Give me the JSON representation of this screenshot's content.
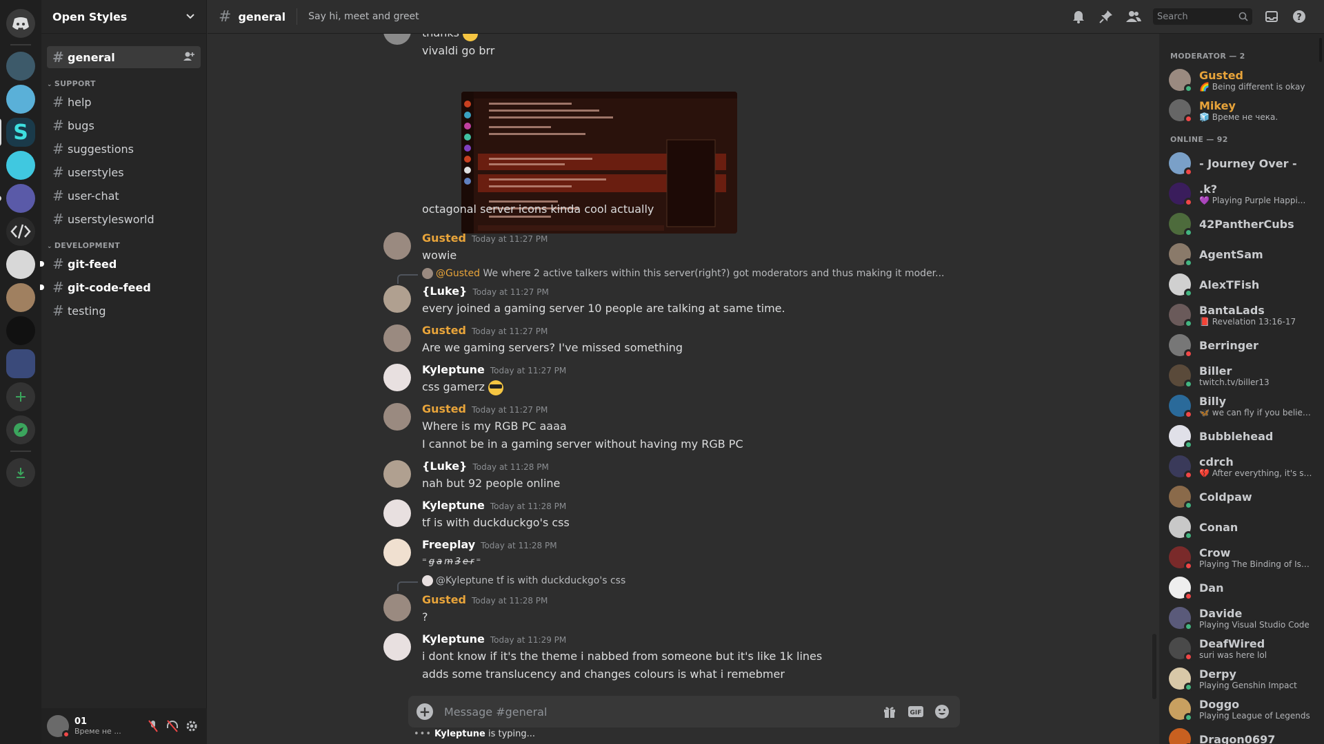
{
  "guild": {
    "name": "Open Styles"
  },
  "channel": {
    "name": "general",
    "topic": "Say hi, meet and greet"
  },
  "channels": {
    "top": [
      {
        "name": "general"
      }
    ],
    "categories": [
      {
        "label": "SUPPORT",
        "channels": [
          "help",
          "bugs",
          "suggestions",
          "userstyles",
          "user-chat",
          "userstylesworld"
        ]
      },
      {
        "label": "DEVELOPMENT",
        "channels": [
          "git-feed",
          "git-code-feed",
          "testing"
        ]
      }
    ]
  },
  "user_panel": {
    "name": "01",
    "status": "Време не ..."
  },
  "search": {
    "placeholder": "Search"
  },
  "messages": {
    "m0": {
      "partial_top": "thanks",
      "line2": "vivaldi go brr",
      "line3": "octagonal server icons kinda cool actually"
    },
    "m1": {
      "author": "Gusted",
      "ts": "Today at 11:27 PM",
      "lines": [
        "wowie"
      ]
    },
    "r1": {
      "mention": "@Gusted",
      "text": "We where 2 active talkers within this server(right?) got moderators and thus making it moder..."
    },
    "m2": {
      "author": "{Luke}",
      "ts": "Today at 11:27 PM",
      "lines": [
        "every joined a gaming server 10 people are talking at same time."
      ]
    },
    "m3": {
      "author": "Gusted",
      "ts": "Today at 11:27 PM",
      "lines": [
        "Are we gaming servers? I've missed something"
      ]
    },
    "m4": {
      "author": "Kyleptune",
      "ts": "Today at 11:27 PM",
      "lines": [
        "css gamerz"
      ]
    },
    "m5": {
      "author": "Gusted",
      "ts": "Today at 11:27 PM",
      "lines": [
        "Where is my RGB PC aaaa",
        "I cannot be in a gaming server without having my RGB PC"
      ]
    },
    "m6": {
      "author": "{Luke}",
      "ts": "Today at 11:28 PM",
      "lines": [
        "nah but 92 people online"
      ]
    },
    "m7": {
      "author": "Kyleptune",
      "ts": "Today at 11:28 PM",
      "lines": [
        "tf is with duckduckgo's css"
      ]
    },
    "m8": {
      "author": "Freeplay",
      "ts": "Today at 11:28 PM",
      "lines": [
        "⁼g̶a̶m̶3̶e̶r̶⁼"
      ]
    },
    "r2": {
      "mention": "@Kyleptune",
      "text": "tf is with duckduckgo's css"
    },
    "m9": {
      "author": "Gusted",
      "ts": "Today at 11:28 PM",
      "lines": [
        "?"
      ]
    },
    "m10": {
      "author": "Kyleptune",
      "ts": "Today at 11:29 PM",
      "lines": [
        "i dont know if it's the theme i nabbed from someone but it's like 1k lines",
        "adds some translucency and changes colours is what i remebmer"
      ]
    }
  },
  "composer": {
    "placeholder": "Message #general"
  },
  "typing": {
    "name": "Kyleptune",
    "suffix": " is typing..."
  },
  "members": {
    "moderator_label": "MODERATOR — 2",
    "online_label": "ONLINE — 92",
    "moderators": [
      {
        "name": "Gusted",
        "activity": "🌈 Being different is okay",
        "avatar": "#9a8a80",
        "status": "#43b581"
      },
      {
        "name": "Mikey",
        "activity": "🧊 Време не чека.",
        "avatar": "#666666",
        "status": "#f04747"
      }
    ],
    "online": [
      {
        "name": "- Journey Over -",
        "activity": "",
        "avatar": "#7aa0c8",
        "status": "#f04747"
      },
      {
        "name": ".k?",
        "activity": "💜 Playing Purple Happi...",
        "avatar": "#3a1d5c",
        "status": "#f04747"
      },
      {
        "name": "42PantherCubs",
        "activity": "",
        "avatar": "#4d6b3c",
        "status": "#43b581"
      },
      {
        "name": "AgentSam",
        "activity": "",
        "avatar": "#8a7a6a",
        "status": "#43b581"
      },
      {
        "name": "AlexTFish",
        "activity": "",
        "avatar": "#d0d0d0",
        "status": "#43b581"
      },
      {
        "name": "BantaLads",
        "activity": "📕 Revelation 13:16-17",
        "avatar": "#6a5a5a",
        "status": "#43b581"
      },
      {
        "name": "Berringer",
        "activity": "",
        "avatar": "#777777",
        "status": "#f04747"
      },
      {
        "name": "Biller",
        "activity": "twitch.tv/biller13",
        "avatar": "#5a4a3a",
        "status": "#43b581"
      },
      {
        "name": "Billy",
        "activity": "🦋 we can fly if you believe...",
        "avatar": "#2a6a9a",
        "status": "#f04747"
      },
      {
        "name": "Bubblehead",
        "activity": "",
        "avatar": "#e0e0e8",
        "status": "#43b581"
      },
      {
        "name": "cdrch",
        "activity": "💔 After everything, it's still ...",
        "avatar": "#3a3a5a",
        "status": "#f04747"
      },
      {
        "name": "Coldpaw",
        "activity": "",
        "avatar": "#8a6a4a",
        "status": "#43b581"
      },
      {
        "name": "Conan",
        "activity": "",
        "avatar": "#c8c8c8",
        "status": "#43b581"
      },
      {
        "name": "Crow",
        "activity": "Playing The Binding of Isaac:...",
        "avatar": "#7a2a2a",
        "status": "#f04747"
      },
      {
        "name": "Dan",
        "activity": "",
        "avatar": "#eeeeee",
        "status": "#f04747"
      },
      {
        "name": "Davide",
        "activity": "Playing Visual Studio Code",
        "avatar": "#5a5a7a",
        "status": "#43b581"
      },
      {
        "name": "DeafWired",
        "activity": "suri was here lol",
        "avatar": "#4a4a4a",
        "status": "#f04747"
      },
      {
        "name": "Derpy",
        "activity": "Playing Genshin Impact",
        "avatar": "#d8c8a8",
        "status": "#43b581"
      },
      {
        "name": "Doggo",
        "activity": "Playing League of Legends",
        "avatar": "#c8a060",
        "status": "#43b581"
      },
      {
        "name": "Dragon0697",
        "activity": "",
        "avatar": "#c86020",
        "status": "#43b581"
      }
    ]
  }
}
